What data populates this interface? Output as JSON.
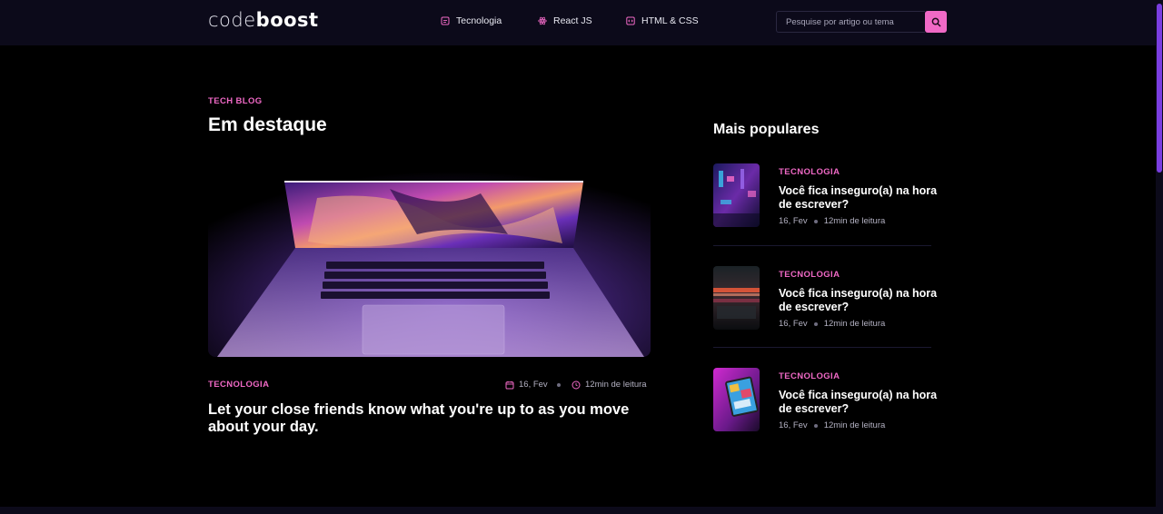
{
  "header": {
    "logo_part1": "code",
    "logo_part2": "boost",
    "nav": [
      {
        "label": "Tecnologia",
        "icon": "document-icon"
      },
      {
        "label": "React JS",
        "icon": "react-atom-icon"
      },
      {
        "label": "HTML & CSS",
        "icon": "code-icon"
      }
    ],
    "search_placeholder": "Pesquise por artigo ou tema",
    "accent_color": "#f069c6"
  },
  "featured": {
    "eyebrow": "TECH BLOG",
    "title": "Em destaque",
    "post": {
      "category": "TECNOLOGIA",
      "date": "16, Fev",
      "read_time": "12min de leitura",
      "title": "Let your close friends know what you're up to as you move about your day."
    }
  },
  "popular": {
    "title": "Mais populares",
    "items": [
      {
        "category": "TECNOLOGIA",
        "title": "Você fica inseguro(a) na hora de escrever?",
        "date": "16, Fev",
        "read_time": "12min de leitura"
      },
      {
        "category": "TECNOLOGIA",
        "title": "Você fica inseguro(a) na hora de escrever?",
        "date": "16, Fev",
        "read_time": "12min de leitura"
      },
      {
        "category": "TECNOLOGIA",
        "title": "Você fica inseguro(a) na hora de escrever?",
        "date": "16, Fev",
        "read_time": "12min de leitura"
      }
    ]
  }
}
